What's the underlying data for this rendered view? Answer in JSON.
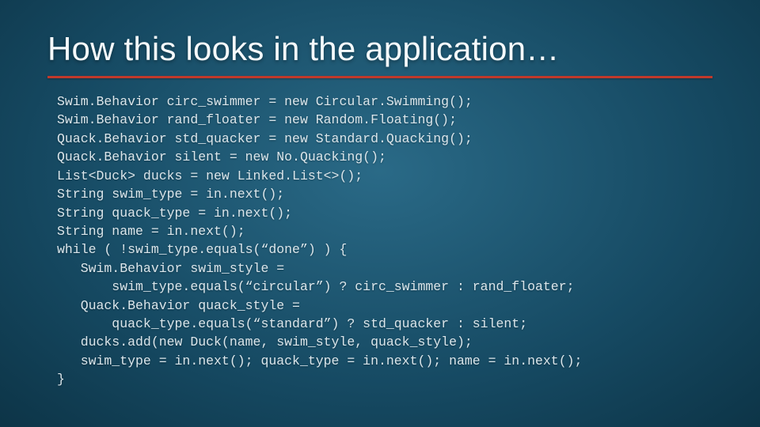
{
  "title": "How this looks in the application…",
  "code_lines": [
    "Swim.Behavior circ_swimmer = new Circular.Swimming();",
    "Swim.Behavior rand_floater = new Random.Floating();",
    "Quack.Behavior std_quacker = new Standard.Quacking();",
    "Quack.Behavior silent = new No.Quacking();",
    "List<Duck> ducks = new Linked.List<>();",
    "String swim_type = in.next();",
    "String quack_type = in.next();",
    "String name = in.next();",
    "while ( !swim_type.equals(“done”) ) {",
    "   Swim.Behavior swim_style =",
    "       swim_type.equals(“circular”) ? circ_swimmer : rand_floater;",
    "   Quack.Behavior quack_style =",
    "       quack_type.equals(“standard”) ? std_quacker : silent;",
    "   ducks.add(new Duck(name, swim_style, quack_style);",
    "   swim_type = in.next(); quack_type = in.next(); name = in.next();",
    "}"
  ]
}
